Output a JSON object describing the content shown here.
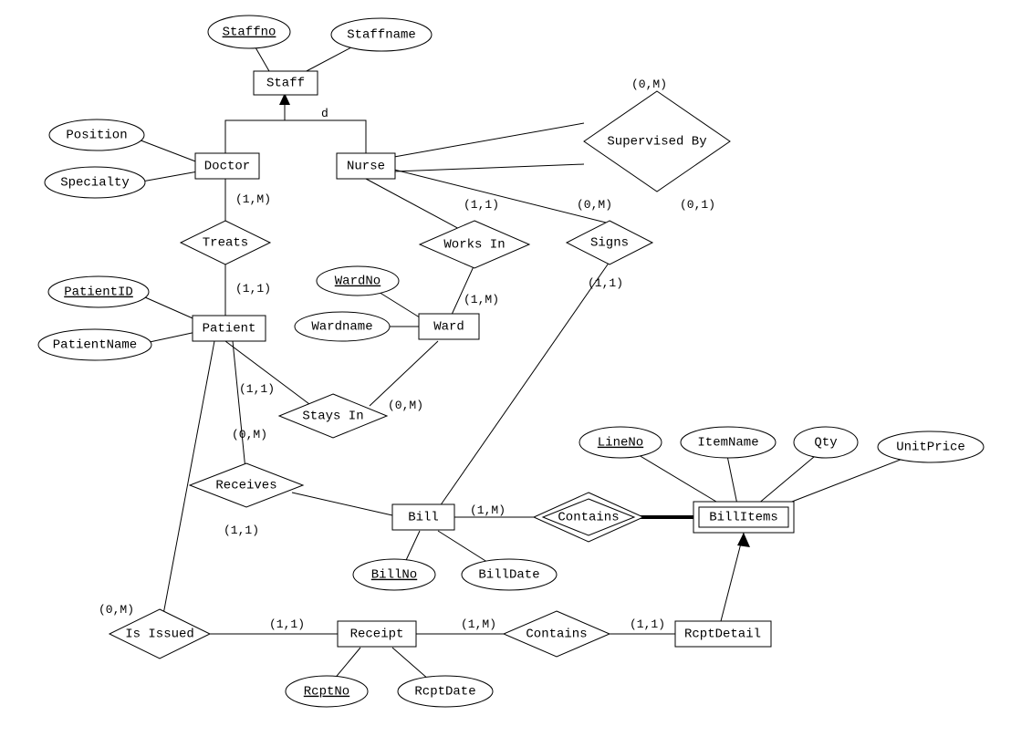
{
  "entities": {
    "staff": "Staff",
    "doctor": "Doctor",
    "nurse": "Nurse",
    "patient": "Patient",
    "ward": "Ward",
    "bill": "Bill",
    "receipt": "Receipt",
    "rcptdetail": "RcptDetail",
    "billitems": "BillItems"
  },
  "attributes": {
    "staffno": "Staffno",
    "staffname": "Staffname",
    "position": "Position",
    "specialty": "Specialty",
    "patientid": "PatientID",
    "patientname": "PatientName",
    "wardno": "WardNo",
    "wardname": "Wardname",
    "billno": "BillNo",
    "billdate": "BillDate",
    "rcptno": "RcptNo",
    "rcptdate": "RcptDate",
    "lineno": "LineNo",
    "itemname": "ItemName",
    "qty": "Qty",
    "unitprice": "UnitPrice"
  },
  "relationships": {
    "supervisedby": "Supervised By",
    "treats": "Treats",
    "worksin": "Works In",
    "signs": "Signs",
    "staysin": "Stays In",
    "receives": "Receives",
    "contains1": "Contains",
    "contains2": "Contains",
    "isissued": "Is Issued"
  },
  "cardinalities": {
    "c_0M_sup": "(0,M)",
    "c_01_sup": "(0,1)",
    "c_1M_treats": "(1,M)",
    "c_11_treats": "(1,1)",
    "c_11_works": "(1,1)",
    "c_1M_works": "(1,M)",
    "c_0M_signs": "(0,M)",
    "c_11_signs": "(1,1)",
    "c_11_stays": "(1,1)",
    "c_0M_stays": "(0,M)",
    "c_0M_rec": "(0,M)",
    "c_11_rec": "(1,1)",
    "c_1M_cont1": "(1,M)",
    "c_0M_iss": "(0,M)",
    "c_11_iss": "(1,1)",
    "c_1M_cont2": "(1,M)",
    "c_11_cont2": "(1,1)"
  },
  "inheritance_label": "d"
}
